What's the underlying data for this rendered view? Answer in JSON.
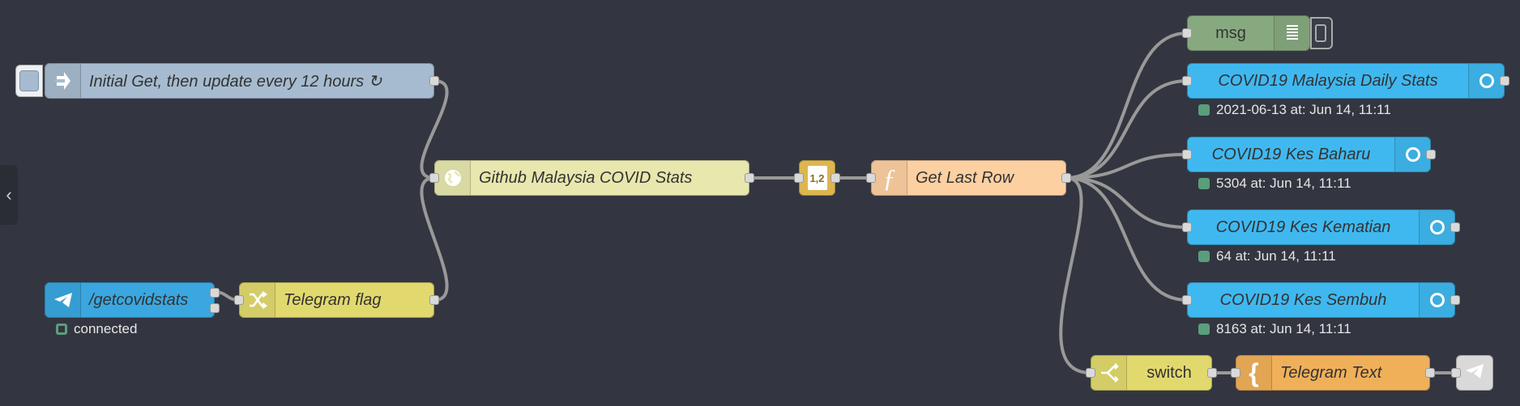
{
  "sidebar": {
    "collapse_icon": "chevron-left-icon"
  },
  "nodes": {
    "inject": {
      "label": "Initial Get, then update every 12 hours ↻",
      "icon": "inject-arrow-icon",
      "color": "#a6bbcf"
    },
    "http": {
      "label": "Github Malaysia COVID Stats",
      "icon": "globe-icon",
      "color": "#e7e7ae"
    },
    "csv": {
      "label": "1,2",
      "icon": "csv-file-icon",
      "color": "#deb64f"
    },
    "function": {
      "label": "Get Last Row",
      "icon": "function-icon",
      "color": "#fdd0a2"
    },
    "debug": {
      "label": "msg",
      "icon": "debug-list-icon",
      "color": "#87a980"
    },
    "telegram_in": {
      "label": "/getcovidstats",
      "icon": "telegram-icon",
      "color": "#3fadb5",
      "status": "connected"
    },
    "change": {
      "label": "Telegram flag",
      "icon": "change-shuffle-icon",
      "color": "#e2d96e"
    },
    "dash1": {
      "label": "COVID19 Malaysia Daily Stats",
      "color": "#3fb8f0",
      "status": "2021-06-13 at: Jun 14, 11:11"
    },
    "dash2": {
      "label": "COVID19 Kes Baharu",
      "color": "#3fb8f0",
      "status": "5304 at: Jun 14, 11:11"
    },
    "dash3": {
      "label": "COVID19 Kes Kematian",
      "color": "#3fb8f0",
      "status": "64 at: Jun 14, 11:11"
    },
    "dash4": {
      "label": "COVID19 Kes Sembuh",
      "color": "#3fb8f0",
      "status": "8163 at: Jun 14, 11:11"
    },
    "switch": {
      "label": "switch",
      "icon": "switch-icon",
      "color": "#e2d96e"
    },
    "template": {
      "label": "Telegram Text",
      "icon": "template-brace-icon",
      "color": "#f0b05a"
    },
    "telegram_out": {
      "label": "",
      "icon": "telegram-send-icon",
      "color": "#d9d9d9"
    }
  }
}
